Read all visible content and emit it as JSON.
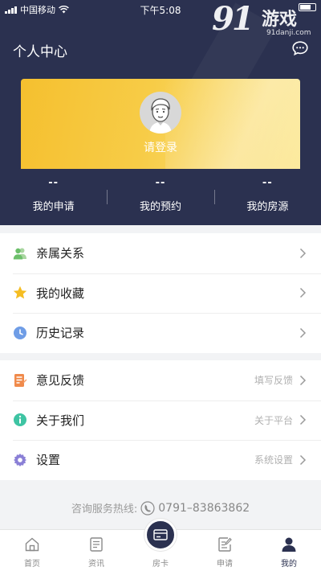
{
  "status_bar": {
    "carrier": "中国移动",
    "time": "下午5:08"
  },
  "watermark": {
    "brand": "91",
    "title": "游戏",
    "domain": "91danji.com"
  },
  "header": {
    "title": "个人中心",
    "message_icon": "message-bubble-icon"
  },
  "profile": {
    "login_label": "请登录",
    "avatar_icon": "default-avatar-icon",
    "accent": "#f5c02f"
  },
  "stats": [
    {
      "count": "--",
      "label": "我的申请"
    },
    {
      "count": "--",
      "label": "我的预约"
    },
    {
      "count": "--",
      "label": "我的房源"
    }
  ],
  "menu_group1": [
    {
      "icon": "relatives-icon",
      "label": "亲属关系",
      "hint": ""
    },
    {
      "icon": "star-icon",
      "label": "我的收藏",
      "hint": ""
    },
    {
      "icon": "clock-icon",
      "label": "历史记录",
      "hint": ""
    }
  ],
  "menu_group2": [
    {
      "icon": "feedback-icon",
      "label": "意见反馈",
      "hint": "填写反馈"
    },
    {
      "icon": "info-icon",
      "label": "关于我们",
      "hint": "关于平台"
    },
    {
      "icon": "settings-gear-icon",
      "label": "设置",
      "hint": "系统设置"
    }
  ],
  "hotline": {
    "label": "咨询服务热线:",
    "number": "0791–83863862"
  },
  "tabs": [
    {
      "icon": "home-icon",
      "label": "首页",
      "active": false
    },
    {
      "icon": "news-icon",
      "label": "资讯",
      "active": false
    },
    {
      "icon": "house-card-icon",
      "label": "房卡",
      "active": false
    },
    {
      "icon": "apply-icon",
      "label": "申请",
      "active": false
    },
    {
      "icon": "profile-icon",
      "label": "我的",
      "active": true
    }
  ],
  "colors": {
    "header_bg": "#2b3150",
    "page_bg": "#f2f3f5",
    "card_gradient_start": "#f5c02f",
    "card_gradient_end": "#fbe68c"
  }
}
